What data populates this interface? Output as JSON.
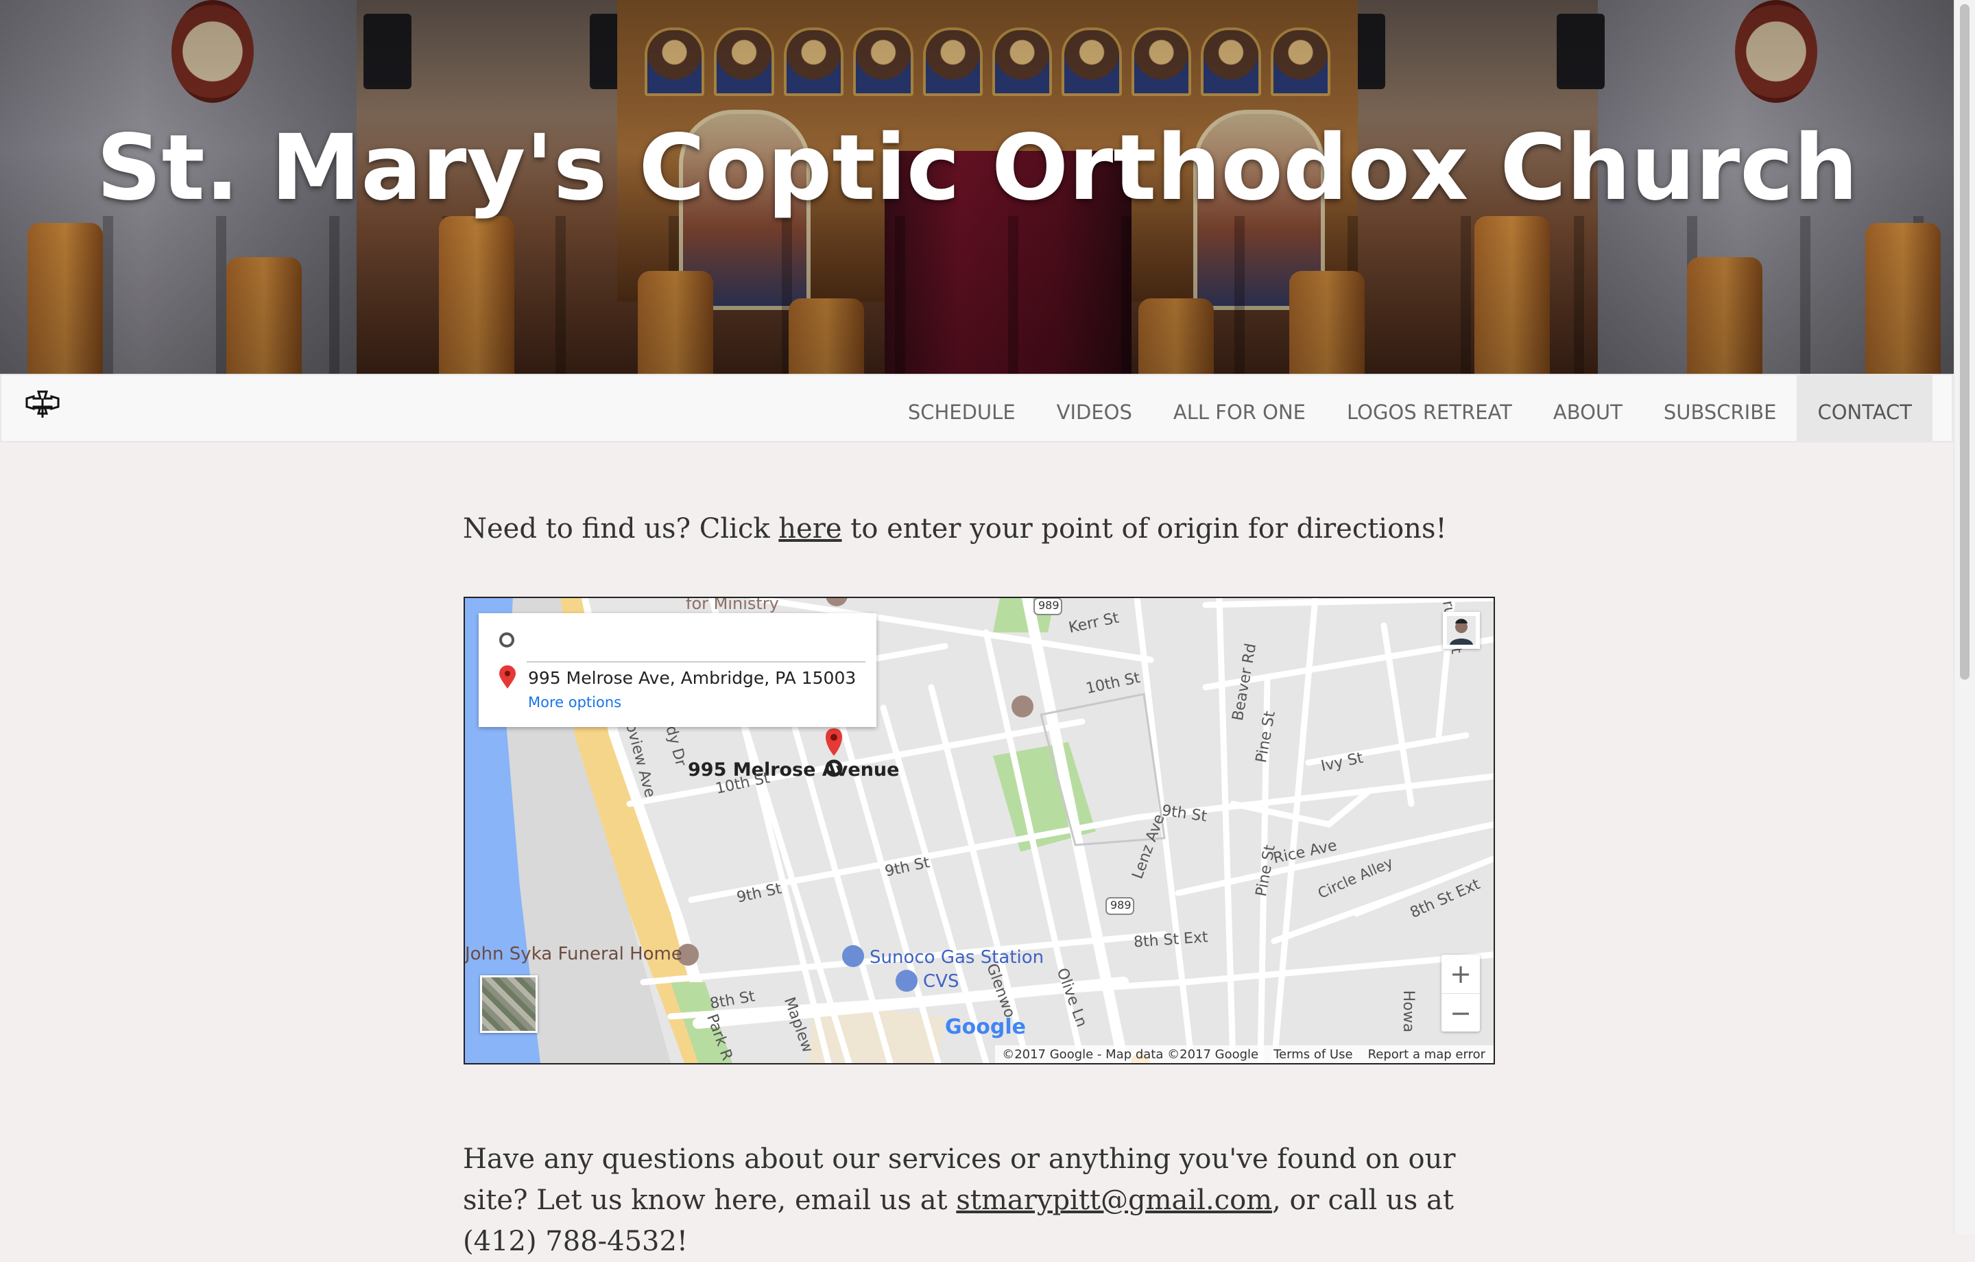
{
  "hero": {
    "title": "St. Mary's Coptic Orthodox Church"
  },
  "nav": {
    "items": [
      {
        "label": "SCHEDULE"
      },
      {
        "label": "VIDEOS"
      },
      {
        "label": "ALL FOR ONE"
      },
      {
        "label": "LOGOS RETREAT"
      },
      {
        "label": "ABOUT"
      },
      {
        "label": "SUBSCRIBE"
      },
      {
        "label": "CONTACT"
      }
    ],
    "active": "CONTACT",
    "logo_icon": "coptic-cross-icon"
  },
  "intro": {
    "before": "Need to find us? Click ",
    "link": "here",
    "after": " to enter your point of origin for directions!"
  },
  "map": {
    "origin_placeholder": "",
    "destination": "995 Melrose Ave, Ambridge, PA 15003",
    "more_options": "More options",
    "pin_label": "995 Melrose Avenue",
    "places": {
      "ministry": "for Ministry",
      "funeral": "John Syka Funeral Home",
      "sunoco": "Sunoco Gas Station",
      "cvs": "CVS"
    },
    "streets": {
      "kerr": "Kerr St",
      "tenth_a": "10th St",
      "tenth_b": "10th St",
      "ninth_a": "9th St",
      "ninth_b": "9th St",
      "ninth_c": "9th St",
      "eighth": "8th St",
      "eighth_ext_a": "8th St Ext",
      "eighth_ext_b": "8th St Ext",
      "beaver": "Beaver Rd",
      "pine_a": "Pine St",
      "pine_b": "Pine St",
      "ivy": "Ivy St",
      "rice": "Rice Ave",
      "circle": "Circle Alley",
      "lenz": "Lenz Ave",
      "olive": "Olive Ln",
      "glenwood": "Glenwo",
      "maple": "Maplew",
      "park": "Park R",
      "river_view": "oview Ave",
      "kennedy": "nedy Dr",
      "spruce": "ruce St",
      "howard": "Howa",
      "route": "989"
    },
    "zoom_in": "+",
    "zoom_out": "−",
    "google": "Google",
    "footer": {
      "copyright": "©2017 Google - Map data ©2017 Google",
      "terms": "Terms of Use",
      "report": "Report a map error"
    }
  },
  "contact": {
    "before": "Have any questions about our services or anything you've found on our site? Let us know here, email us at ",
    "email": "stmarypitt@gmail.com",
    "after": ", or call us at (412) 788-4532!"
  }
}
